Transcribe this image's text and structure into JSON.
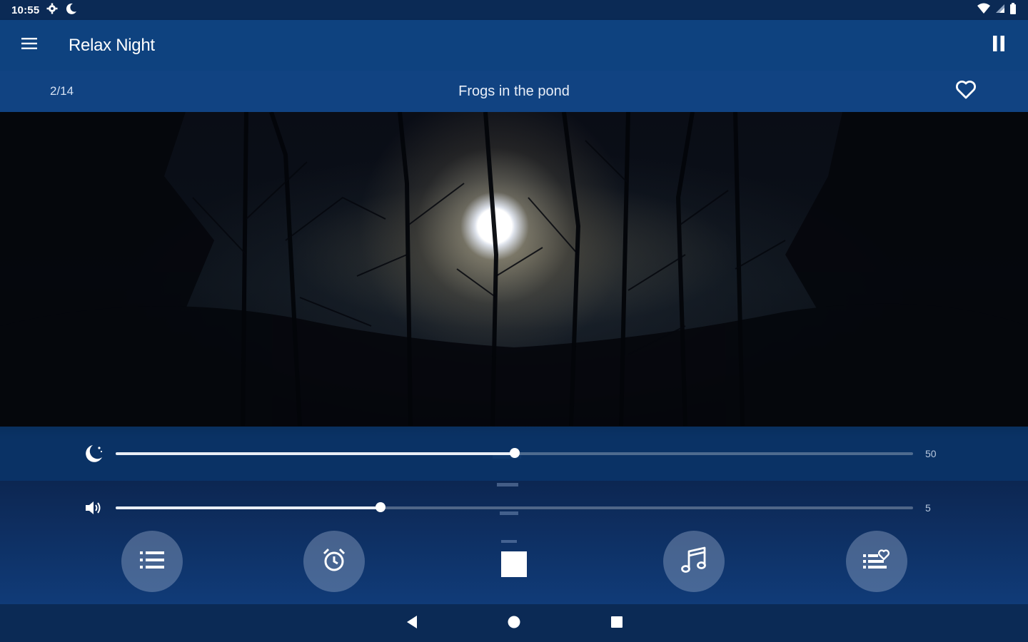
{
  "status_bar": {
    "time": "10:55",
    "left_icons": [
      "gear-icon",
      "moon-icon"
    ],
    "right_icons": [
      "wifi-icon",
      "signal-icon",
      "battery-icon"
    ]
  },
  "app_bar": {
    "title": "Relax Night",
    "menu_icon": "menu-icon",
    "pause_icon": "pause-icon"
  },
  "track": {
    "position": "2/14",
    "title": "Frogs in the pond",
    "favorite_icon": "heart-outline-icon"
  },
  "sleep_slider": {
    "icon": "moon-stars-icon",
    "value": "50",
    "fraction": 0.5
  },
  "volume_slider": {
    "icon": "speaker-icon",
    "value": "5",
    "fraction": 0.332
  },
  "controls": {
    "buttons": [
      "list-icon",
      "alarm-clock-icon",
      "stop-icon",
      "music-note-icon",
      "favorites-list-icon"
    ]
  },
  "nav_bar": {
    "buttons": [
      "back-icon",
      "home-icon",
      "recents-icon"
    ]
  },
  "colors": {
    "app_bar": "#0e427f",
    "track_bar": "#12488a",
    "status_bar": "#0b2a55",
    "accent": "#ffffff"
  }
}
